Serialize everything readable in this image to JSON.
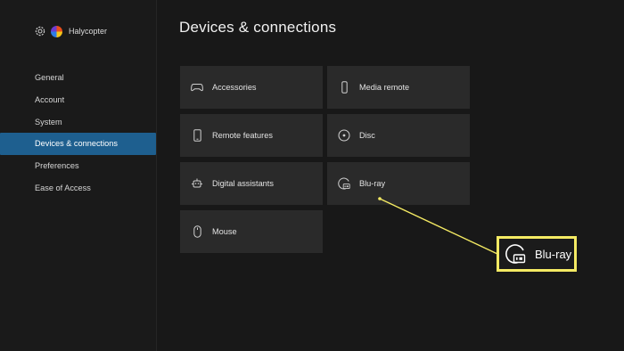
{
  "profile": {
    "name": "Halycopter",
    "settings_icon": "gear-icon"
  },
  "sidebar": {
    "items": [
      {
        "label": "General",
        "active": false
      },
      {
        "label": "Account",
        "active": false
      },
      {
        "label": "System",
        "active": false
      },
      {
        "label": "Devices & connections",
        "active": true
      },
      {
        "label": "Preferences",
        "active": false
      },
      {
        "label": "Ease of Access",
        "active": false
      }
    ]
  },
  "main": {
    "title": "Devices & connections",
    "tiles": [
      {
        "label": "Accessories",
        "icon": "gamepad-icon"
      },
      {
        "label": "Remote features",
        "icon": "phone-icon"
      },
      {
        "label": "Digital assistants",
        "icon": "assistant-icon"
      },
      {
        "label": "Mouse",
        "icon": "mouse-icon"
      },
      {
        "label": "Media remote",
        "icon": "remote-icon"
      },
      {
        "label": "Disc",
        "icon": "disc-icon"
      },
      {
        "label": "Blu-ray",
        "icon": "bluray-icon"
      }
    ]
  },
  "callout": {
    "label": "Blu-ray",
    "icon": "bluray-icon",
    "border_color": "#f4ea63"
  },
  "colors": {
    "accent": "#1e5f8f",
    "tile_bg": "#2a2a2a",
    "background": "#181818",
    "highlight": "#f4ea63"
  }
}
